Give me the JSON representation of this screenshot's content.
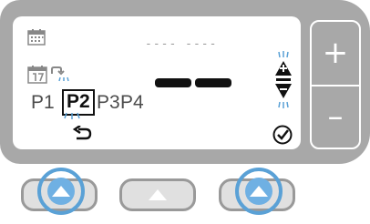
{
  "screen": {
    "date_placeholder": "---- ----",
    "programs": [
      "P1",
      "P2",
      "P3",
      "P4"
    ],
    "selected_program": "P2"
  },
  "side_buttons": {
    "plus_label": "+",
    "minus_label": "–"
  },
  "icons": {
    "calendar": "calendar-icon",
    "calendar_7day": "calendar-7day-icon",
    "program_pointer": "program-pointer-icon",
    "back": "back-arrow-icon",
    "confirm": "check-circle-icon",
    "up_down": "up-down-arrows-icon"
  },
  "hardware_buttons": [
    {
      "name": "left",
      "highlighted": true
    },
    {
      "name": "middle",
      "highlighted": false
    },
    {
      "name": "right",
      "highlighted": true
    }
  ],
  "colors": {
    "device_body": "#a8a8a8",
    "screen": "#ffffff",
    "highlight": "#5aa1d6",
    "blink_rays": "#5aa1d6"
  }
}
